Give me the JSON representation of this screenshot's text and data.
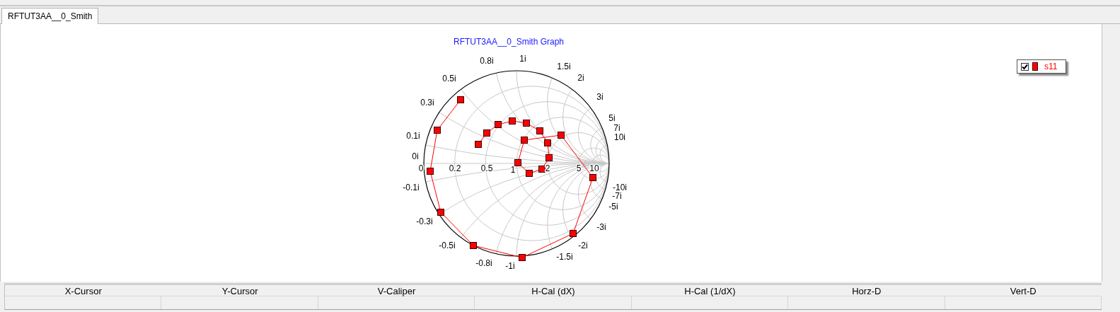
{
  "tabs": [
    {
      "label": "RFTUT3AA__0_Smith",
      "selected": true
    }
  ],
  "chart": {
    "title": "RFTUT3AA__0_Smith Graph",
    "reactance_labels": [
      "1i",
      "0.8i",
      "1.5i",
      "2i",
      "0.5i",
      "3i",
      "0.3i",
      "5i",
      "7i",
      "0.1i",
      "10i",
      "0i",
      "-0.1i",
      "-10i",
      "-7i",
      "-5i",
      "-0.3i",
      "-3i",
      "-0.5i",
      "-2i",
      "-1.5i",
      "-0.8i",
      "-1i"
    ],
    "resistance_labels": [
      "0",
      "0.2",
      "0.5",
      "1",
      "2",
      "5",
      "10"
    ]
  },
  "legend": [
    {
      "label": "s11",
      "checked": true,
      "color": "#ff0000"
    }
  ],
  "cursor_table": {
    "columns": [
      "X-Cursor",
      "Y-Cursor",
      "V-Caliper",
      "H-Cal (dX)",
      "H-Cal (1/dX)",
      "Horz-D",
      "Vert-D"
    ]
  }
}
